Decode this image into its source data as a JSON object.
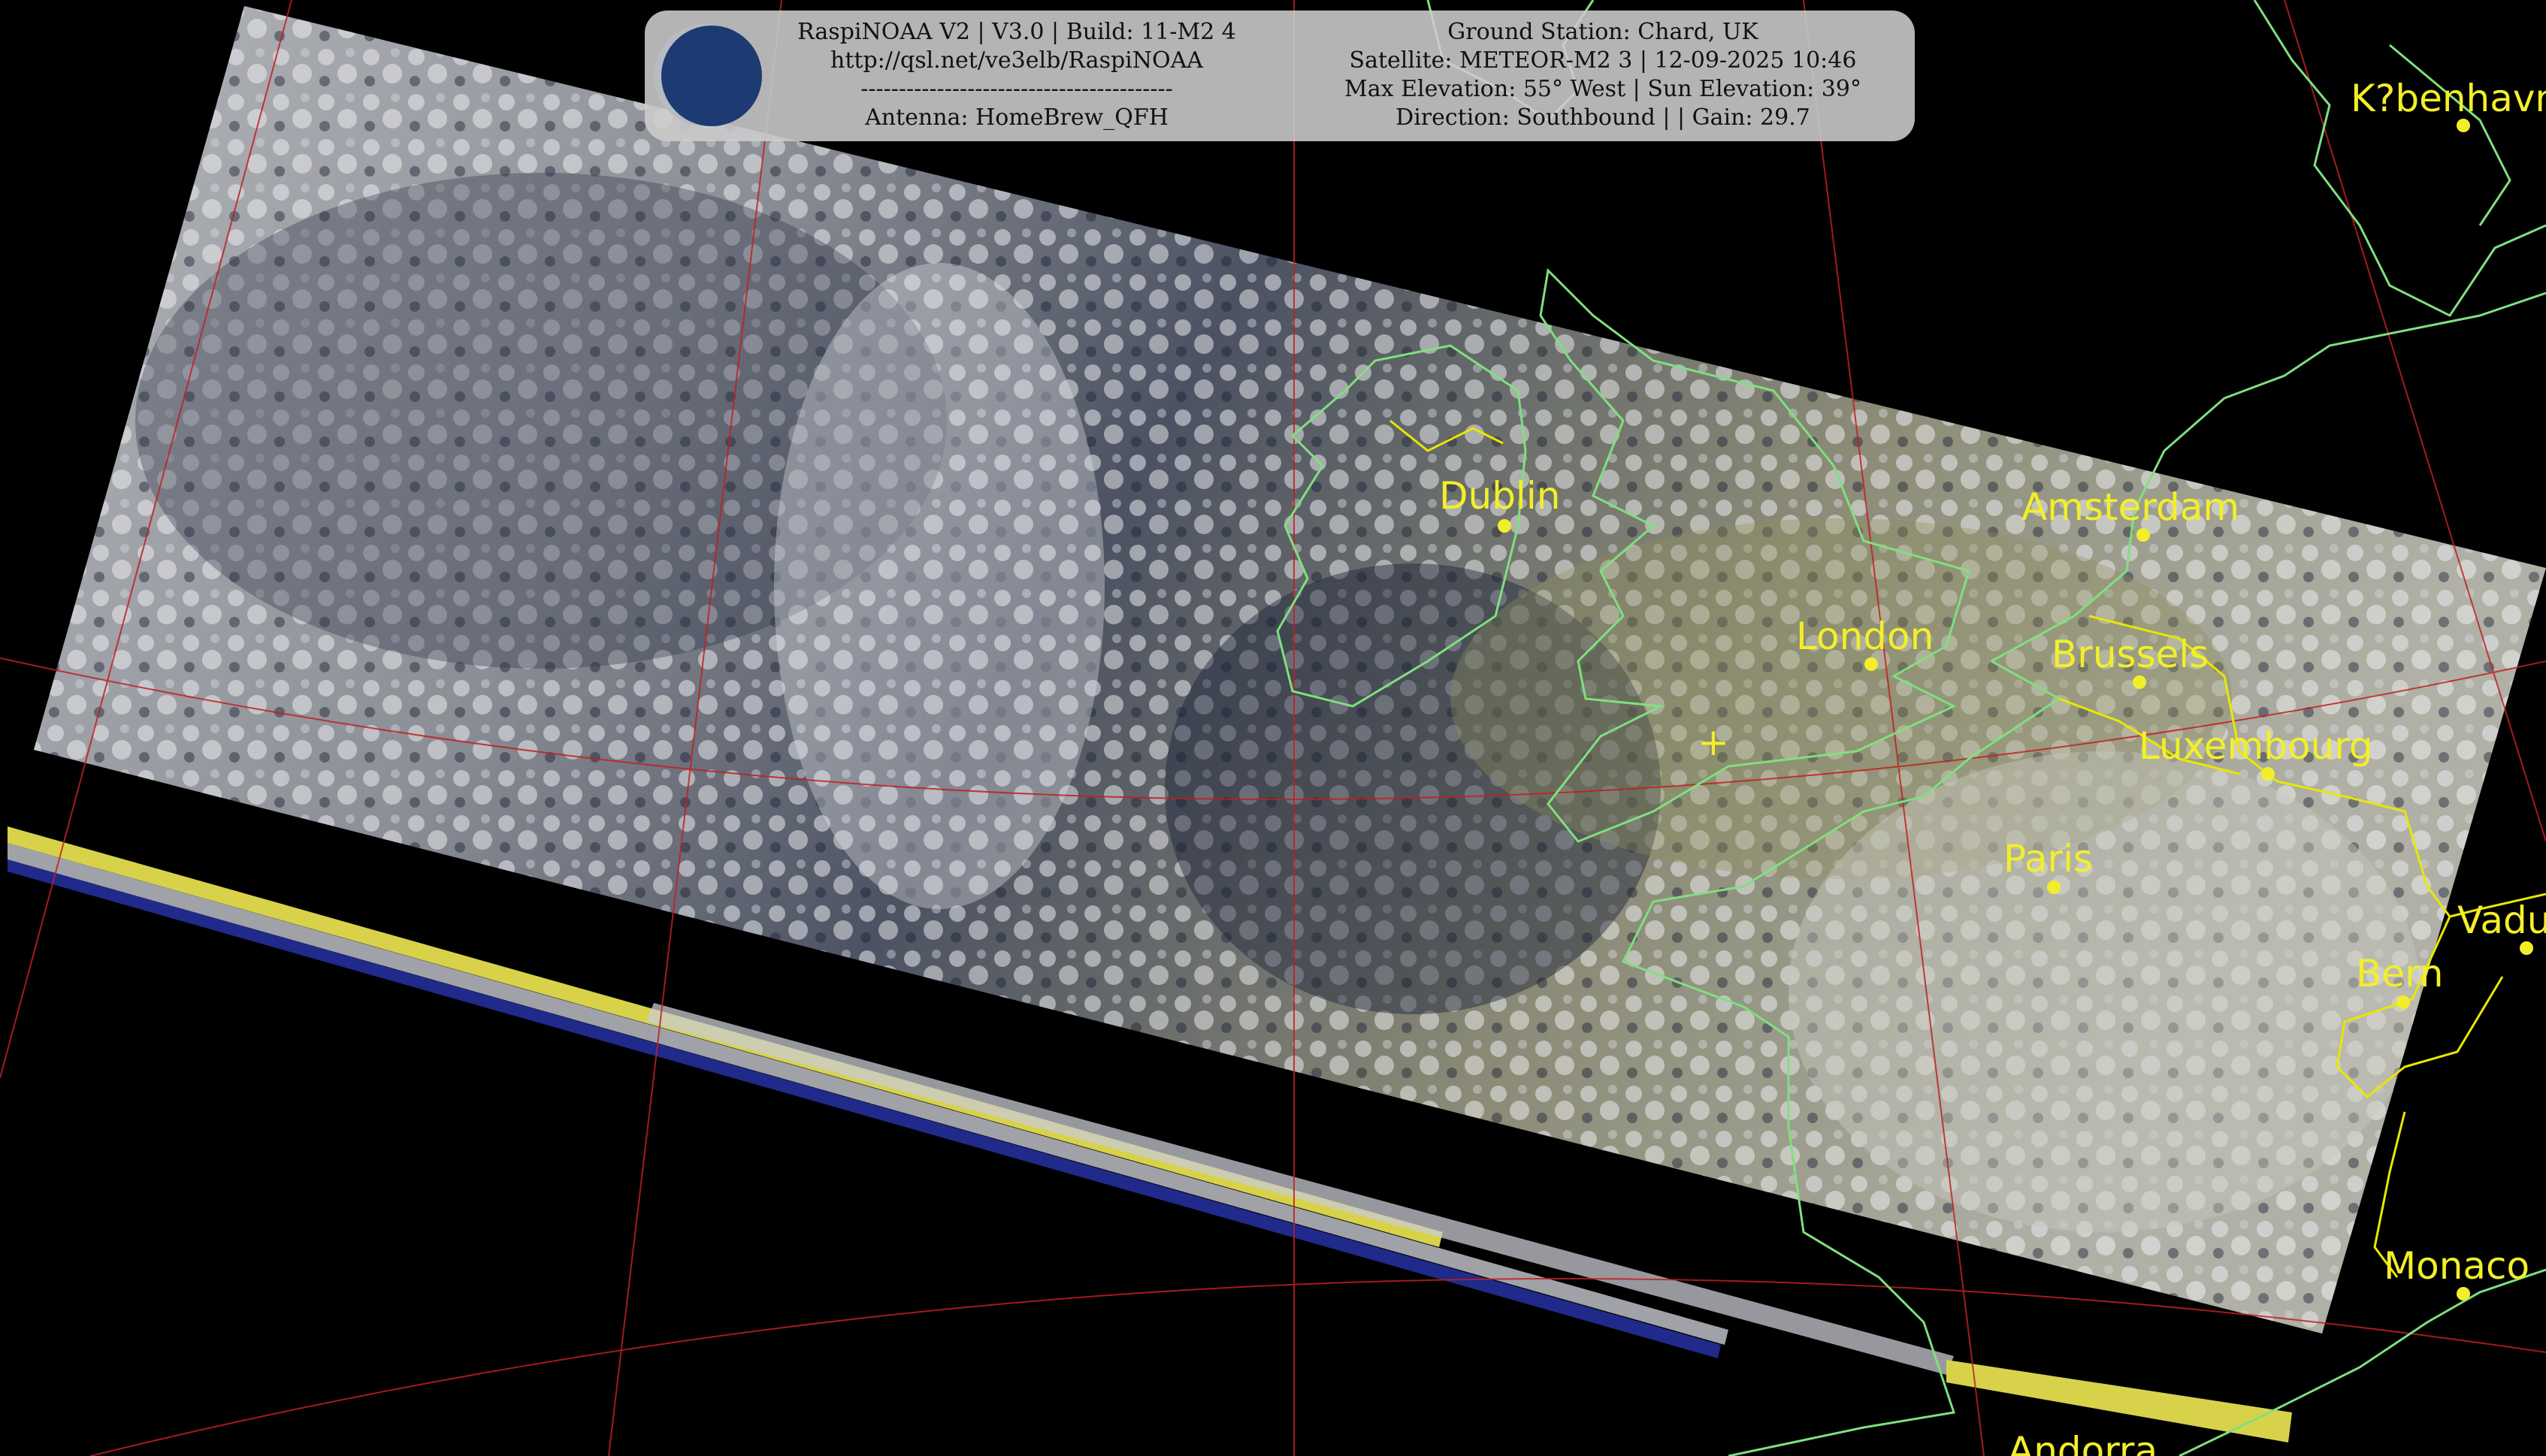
{
  "header": {
    "left_lines": [
      "RaspiNOAA V2 | V3.0 | Build: 11-M2 4",
      "http://qsl.net/ve3elb/RaspiNOAA",
      "-----------------------------------------",
      "Antenna: HomeBrew_QFH"
    ],
    "right_lines": [
      "Ground Station: Chard, UK",
      "Satellite: METEOR-M2 3 | 12-09-2025 10:46",
      "Max Elevation: 55° West | Sun Elevation: 39°",
      "Direction: Southbound | | Gain: 29.7"
    ]
  },
  "logo_icon": "satellite-icon",
  "ground_station_marker": "+",
  "cities": [
    {
      "name": "K?benhavn"
    },
    {
      "name": "Dublin"
    },
    {
      "name": "Amsterdam"
    },
    {
      "name": "London"
    },
    {
      "name": "Brussels"
    },
    {
      "name": "Luxembourg"
    },
    {
      "name": "Paris"
    },
    {
      "name": "Vaduz"
    },
    {
      "name": "Bern"
    },
    {
      "name": "Monaco"
    },
    {
      "name": "Andorra"
    }
  ],
  "colors": {
    "background": "#000000",
    "coastline": "#7fe07f",
    "borders": "#e8e800",
    "graticule": "#c02020",
    "city": "#f2ef2a",
    "panel": "#cdcdcd"
  }
}
